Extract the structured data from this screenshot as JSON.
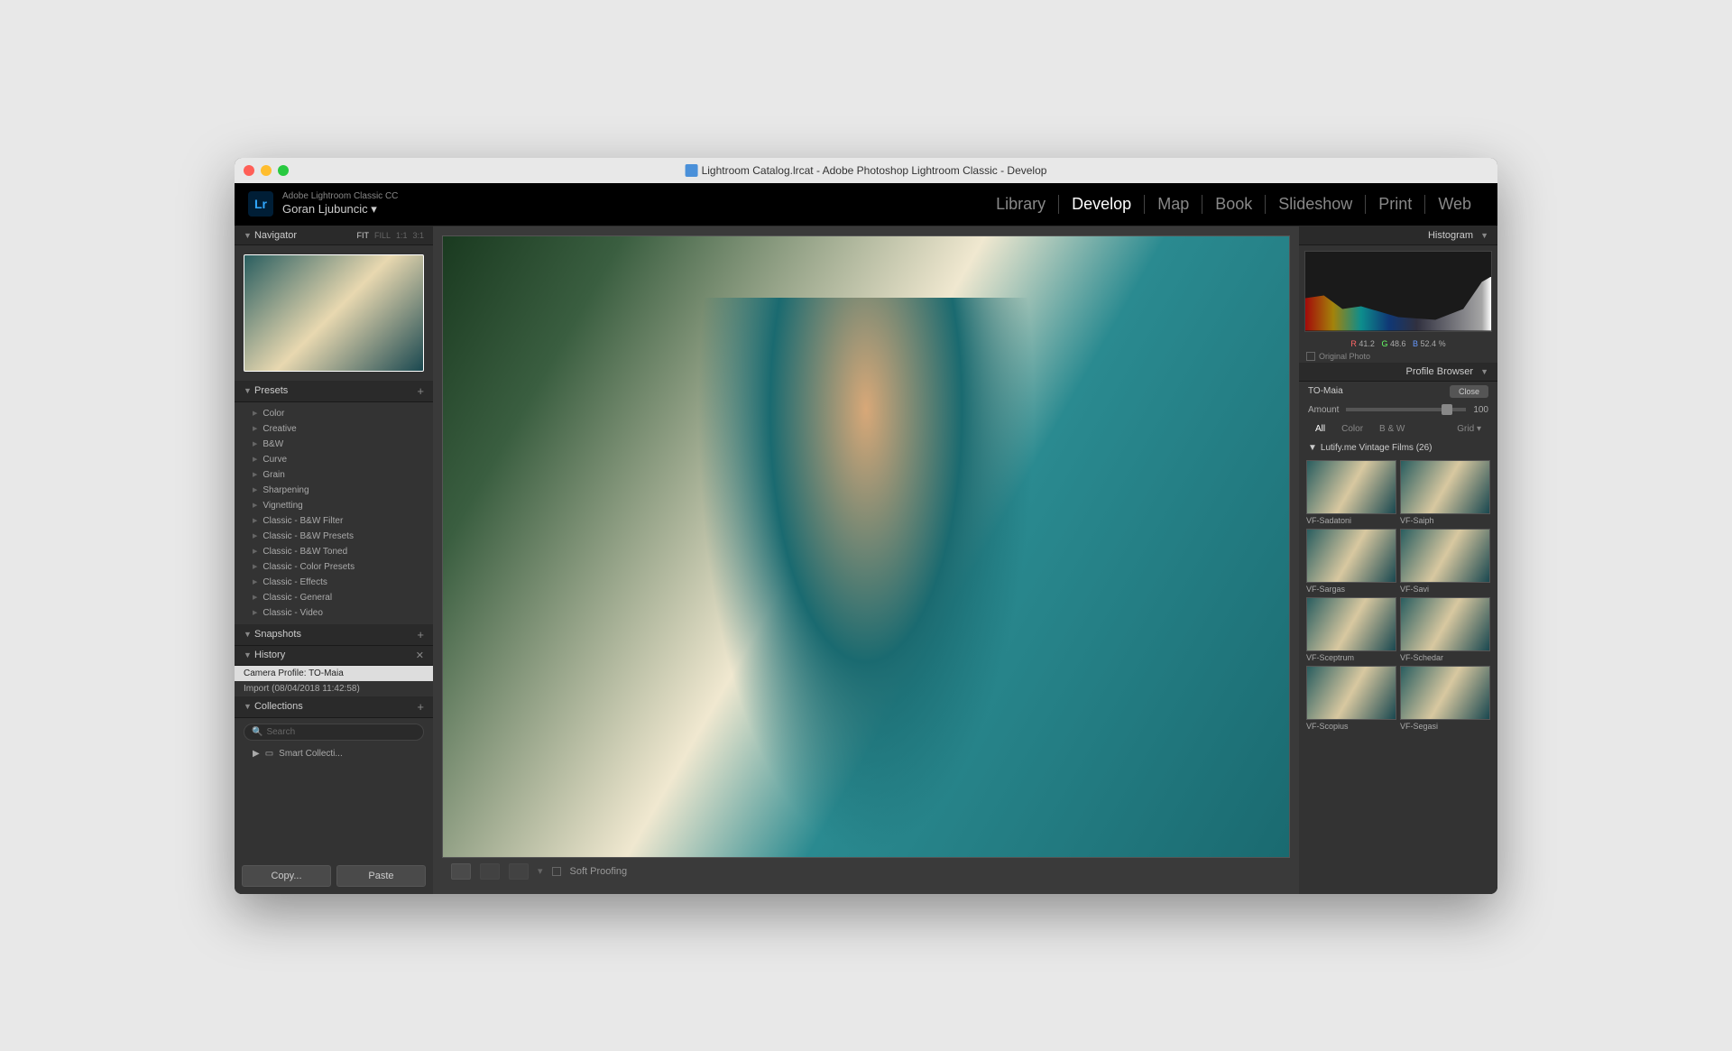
{
  "window_title": "Lightroom Catalog.lrcat - Adobe Photoshop Lightroom Classic - Develop",
  "app_name": "Adobe Lightroom Classic CC",
  "user_name": "Goran Ljubuncic",
  "logo_text": "Lr",
  "modules": [
    "Library",
    "Develop",
    "Map",
    "Book",
    "Slideshow",
    "Print",
    "Web"
  ],
  "active_module": "Develop",
  "navigator": {
    "title": "Navigator",
    "zoom_levels": [
      "FIT",
      "FILL",
      "1:1",
      "3:1"
    ],
    "active_zoom": "FIT"
  },
  "presets": {
    "title": "Presets",
    "items": [
      "Color",
      "Creative",
      "B&W",
      "Curve",
      "Grain",
      "Sharpening",
      "Vignetting",
      "Classic - B&W Filter",
      "Classic - B&W Presets",
      "Classic - B&W Toned",
      "Classic - Color Presets",
      "Classic - Effects",
      "Classic - General",
      "Classic - Video"
    ]
  },
  "snapshots": {
    "title": "Snapshots"
  },
  "history": {
    "title": "History",
    "items": [
      {
        "label": "Camera Profile: TO-Maia",
        "selected": true
      },
      {
        "label": "Import (08/04/2018 11:42:58)",
        "selected": false
      }
    ]
  },
  "collections": {
    "title": "Collections",
    "search_placeholder": "Search",
    "items": [
      "Smart Collecti..."
    ]
  },
  "buttons": {
    "copy": "Copy...",
    "paste": "Paste"
  },
  "toolbar": {
    "soft_proofing": "Soft Proofing"
  },
  "histogram": {
    "title": "Histogram",
    "r_label": "R",
    "r_value": "41.2",
    "g_label": "G",
    "g_value": "48.6",
    "b_label": "B",
    "b_value": "52.4",
    "percent": "%",
    "original_photo": "Original Photo"
  },
  "profile_browser": {
    "title": "Profile Browser",
    "current_profile": "TO-Maia",
    "close": "Close",
    "amount_label": "Amount",
    "amount_value": "100",
    "filters": [
      "All",
      "Color",
      "B & W"
    ],
    "active_filter": "All",
    "view_mode": "Grid",
    "section_title": "Lutify.me Vintage Films (26)",
    "profiles": [
      "VF-Sadatoni",
      "VF-Saiph",
      "VF-Sargas",
      "VF-Savi",
      "VF-Sceptrum",
      "VF-Schedar",
      "VF-Scopius",
      "VF-Segasi"
    ]
  }
}
